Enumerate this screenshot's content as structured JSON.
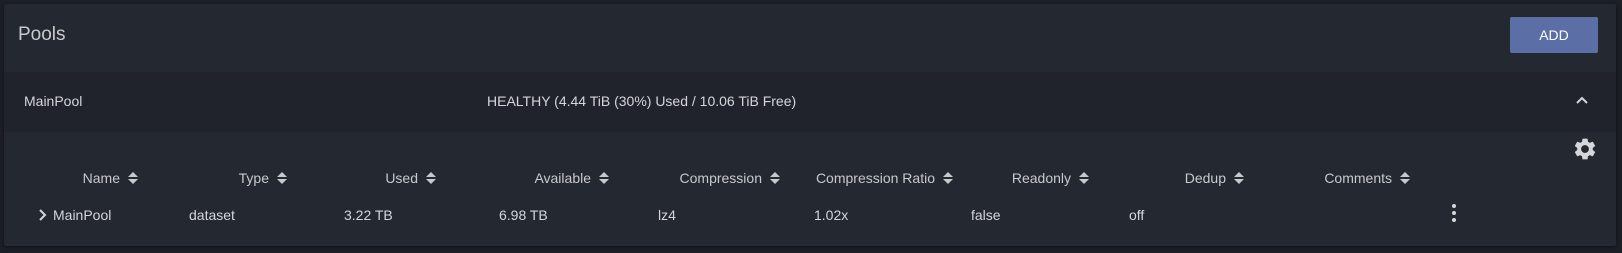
{
  "header": {
    "title": "Pools",
    "add_label": "ADD"
  },
  "pool": {
    "name": "MainPool",
    "status": "HEALTHY (4.44 TiB (30%) Used / 10.06 TiB Free)"
  },
  "table": {
    "columns": [
      "Name",
      "Type",
      "Used",
      "Available",
      "Compression",
      "Compression Ratio",
      "Readonly",
      "Dedup",
      "Comments"
    ],
    "rows": [
      {
        "name": "MainPool",
        "type": "dataset",
        "used": "3.22 TB",
        "available": "6.98 TB",
        "compression": "lz4",
        "compression_ratio": "1.02x",
        "readonly": "false",
        "dedup": "off",
        "comments": ""
      }
    ]
  },
  "icons": {
    "collapse": "chevron-up-icon",
    "settings": "gear-icon",
    "sort": "sort-icon",
    "expand": "chevron-right-icon",
    "menu": "more-vertical-icon"
  },
  "colors": {
    "accent": "#5b6fa6",
    "card": "#242831",
    "pool_bar": "#20232b",
    "background": "#1c1f26"
  }
}
